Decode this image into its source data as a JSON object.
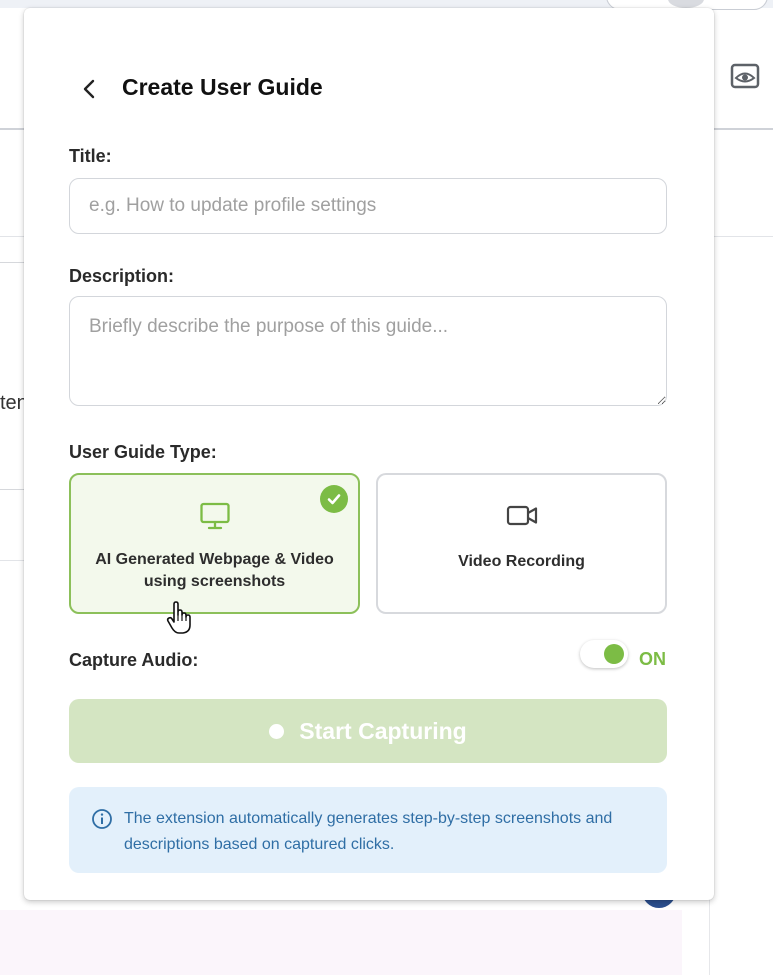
{
  "background": {
    "partial_text": "ten"
  },
  "header": {
    "title": "Create User Guide"
  },
  "form": {
    "title_label": "Title:",
    "title_placeholder": "e.g. How to update profile settings",
    "title_value": "",
    "description_label": "Description:",
    "description_placeholder": "Briefly describe the purpose of this guide...",
    "description_value": "",
    "type_label": "User Guide Type:",
    "types": [
      {
        "label": "AI Generated Webpage & Video using screenshots",
        "icon": "monitor-icon",
        "selected": true
      },
      {
        "label": "Video Recording",
        "icon": "video-camera-icon",
        "selected": false
      }
    ],
    "capture_audio_label": "Capture Audio:",
    "capture_audio_state": "ON",
    "capture_audio_on": true
  },
  "start_button": {
    "label": "Start Capturing",
    "enabled": false
  },
  "info": {
    "text": "The extension automatically generates step-by-step screenshots and descriptions based on captured clicks."
  },
  "colors": {
    "accent_green": "#7cbc45",
    "selected_card_bg": "#f3f9ec",
    "disabled_button_bg": "#d4e5c2",
    "info_bg": "#e3f0fb",
    "info_text": "#2f6ea5"
  }
}
